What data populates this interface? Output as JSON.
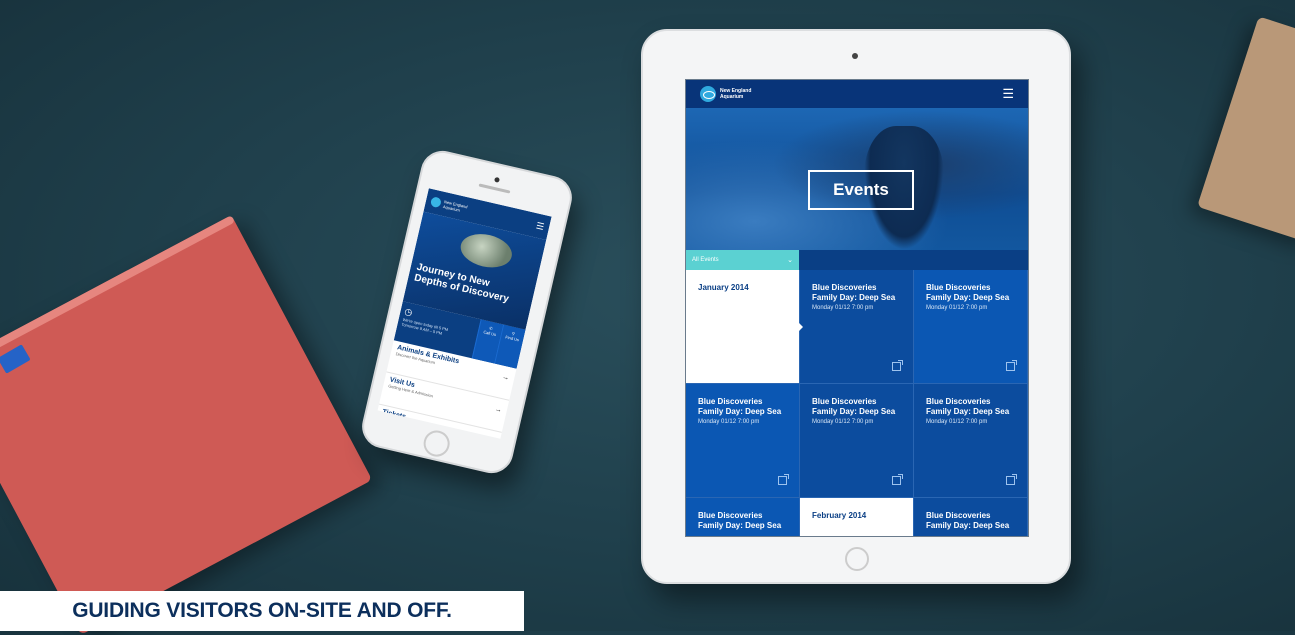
{
  "phone": {
    "brand": "New England Aquarium",
    "hero_title": "Journey to New Depths of Discovery",
    "hours_text": "We're open today till 5 PM",
    "hours_sub": "Tomorrow 9 AM – 5 PM",
    "call": "Call Us",
    "find": "Find Us",
    "rows": [
      {
        "title": "Animals & Exhibits",
        "sub": "Discover the Aquarium"
      },
      {
        "title": "Visit Us",
        "sub": "Getting Here & Admission"
      },
      {
        "title": "Tickets",
        "sub": ""
      }
    ]
  },
  "tablet": {
    "brand": "New England Aquarium",
    "hero_title": "Events",
    "filter_label": "All Events",
    "grid": [
      {
        "type": "month",
        "label": "January 2014"
      },
      {
        "type": "event",
        "title": "Blue Discoveries Family Day: Deep Sea",
        "date": "Monday 01/12 7:00 pm"
      },
      {
        "type": "event",
        "title": "Blue Discoveries Family Day: Deep Sea",
        "date": "Monday 01/12 7:00 pm"
      },
      {
        "type": "event",
        "title": "Blue Discoveries Family Day: Deep Sea",
        "date": "Monday 01/12 7:00 pm"
      },
      {
        "type": "event",
        "title": "Blue Discoveries Family Day: Deep Sea",
        "date": "Monday 01/12 7:00 pm"
      },
      {
        "type": "event",
        "title": "Blue Discoveries Family Day: Deep Sea",
        "date": "Monday 01/12 7:00 pm"
      },
      {
        "type": "event",
        "title": "Blue Discoveries Family Day: Deep Sea",
        "date": ""
      },
      {
        "type": "month",
        "label": "February 2014"
      },
      {
        "type": "event",
        "title": "Blue Discoveries Family Day: Deep Sea",
        "date": ""
      }
    ]
  },
  "caption": "GUIDING VISITORS ON-SITE AND OFF.",
  "colors": {
    "brand_blue": "#0a3f85",
    "accent_teal": "#5bd1d2",
    "background": "#1f3f4b"
  }
}
